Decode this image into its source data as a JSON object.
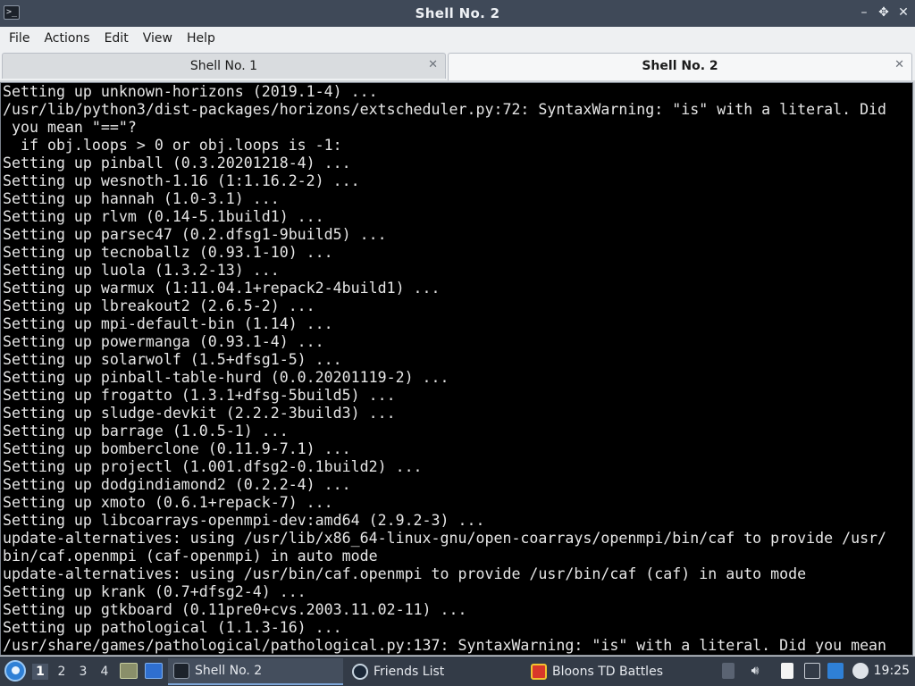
{
  "window": {
    "title": "Shell No. 2",
    "controls": {
      "minimize": "–",
      "restore": "✥",
      "close": "✕"
    }
  },
  "menu": [
    "File",
    "Actions",
    "Edit",
    "View",
    "Help"
  ],
  "tabs": [
    {
      "label": "Shell No. 1",
      "active": false,
      "close": "✕"
    },
    {
      "label": "Shell No. 2",
      "active": true,
      "close": "✕"
    }
  ],
  "terminal": {
    "lines": [
      "Setting up unknown-horizons (2019.1-4) ...",
      "/usr/lib/python3/dist-packages/horizons/extscheduler.py:72: SyntaxWarning: \"is\" with a literal. Did",
      " you mean \"==\"?",
      "  if obj.loops > 0 or obj.loops is -1:",
      "Setting up pinball (0.3.20201218-4) ...",
      "Setting up wesnoth-1.16 (1:1.16.2-2) ...",
      "Setting up hannah (1.0-3.1) ...",
      "Setting up rlvm (0.14-5.1build1) ...",
      "Setting up parsec47 (0.2.dfsg1-9build5) ...",
      "Setting up tecnoballz (0.93.1-10) ...",
      "Setting up luola (1.3.2-13) ...",
      "Setting up warmux (1:11.04.1+repack2-4build1) ...",
      "Setting up lbreakout2 (2.6.5-2) ...",
      "Setting up mpi-default-bin (1.14) ...",
      "Setting up powermanga (0.93.1-4) ...",
      "Setting up solarwolf (1.5+dfsg1-5) ...",
      "Setting up pinball-table-hurd (0.0.20201119-2) ...",
      "Setting up frogatto (1.3.1+dfsg-5build5) ...",
      "Setting up sludge-devkit (2.2.2-3build3) ...",
      "Setting up barrage (1.0.5-1) ...",
      "Setting up bomberclone (0.11.9-7.1) ...",
      "Setting up projectl (1.001.dfsg2-0.1build2) ...",
      "Setting up dodgindiamond2 (0.2.2-4) ...",
      "Setting up xmoto (0.6.1+repack-7) ...",
      "Setting up libcoarrays-openmpi-dev:amd64 (2.9.2-3) ...",
      "update-alternatives: using /usr/lib/x86_64-linux-gnu/open-coarrays/openmpi/bin/caf to provide /usr/",
      "bin/caf.openmpi (caf-openmpi) in auto mode",
      "update-alternatives: using /usr/bin/caf.openmpi to provide /usr/bin/caf (caf) in auto mode",
      "Setting up krank (0.7+dfsg2-4) ...",
      "Setting up gtkboard (0.11pre0+cvs.2003.11.02-11) ...",
      "Setting up pathological (1.1.3-16) ...",
      "/usr/share/games/pathological/pathological.py:137: SyntaxWarning: \"is\" with a literal. Did you mean"
    ]
  },
  "taskbar": {
    "desktops": [
      "1",
      "2",
      "3",
      "4"
    ],
    "active_desktop": "1",
    "tasks": [
      {
        "label": "Shell No. 2",
        "icon": "terminal-icon",
        "active": true
      },
      {
        "label": "Friends List",
        "icon": "steam-icon",
        "active": false
      },
      {
        "label": "Bloons TD Battles",
        "icon": "bloons-icon",
        "active": false
      }
    ],
    "clock": "19:25"
  },
  "colors": {
    "titlebar": "#3f4958",
    "terminal_bg": "#000000",
    "terminal_fg": "#e6e6e6",
    "taskbar": "#333b47"
  }
}
